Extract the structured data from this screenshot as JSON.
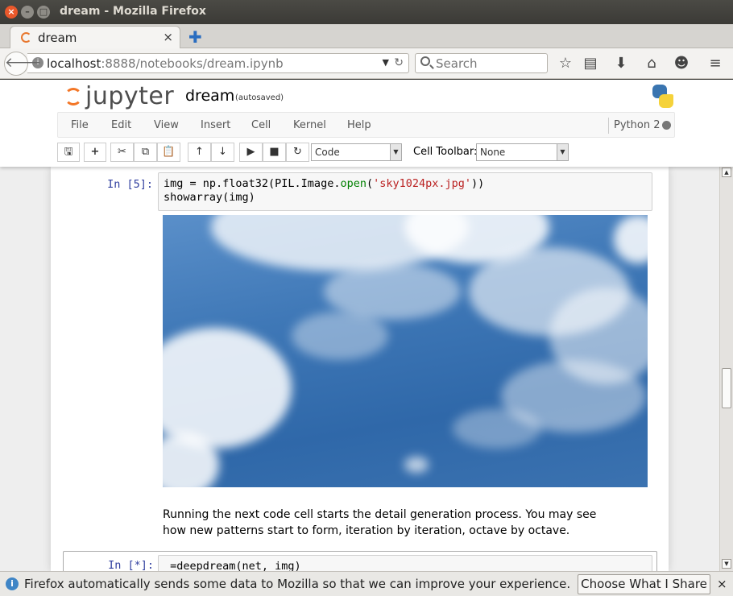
{
  "window": {
    "title": "dream - Mozilla Firefox"
  },
  "tab": {
    "label": "dream",
    "close": "×",
    "new": "✚"
  },
  "navbar": {
    "url_host": "localhost",
    "url_path": ":8888/notebooks/dream.ipynb",
    "search_placeholder": "Search"
  },
  "jupyter": {
    "logo_text": "jupyter",
    "notebook_name": "dream",
    "save_status": "(autosaved)",
    "menu": [
      "File",
      "Edit",
      "View",
      "Insert",
      "Cell",
      "Kernel",
      "Help"
    ],
    "kernel_name": "Python 2",
    "cell_type": "Code",
    "cell_toolbar_label": "Cell Toolbar:",
    "cell_toolbar_value": "None"
  },
  "cells": {
    "cell1_prompt": "In [5]:",
    "cell1_line1_a": "img = np.float32(PIL.Image.",
    "cell1_line1_fn": "open",
    "cell1_line1_b": "(",
    "cell1_line1_str": "'sky1024px.jpg'",
    "cell1_line1_c": "))",
    "cell1_line2": "showarray(img)",
    "markdown": "Running the next code cell starts the detail generation process. You may see how new patterns start to form, iteration by iteration, octave by octave.",
    "cell2_prompt": "In [*]:",
    "cell2_code": "_=deepdream(net, img)"
  },
  "notification": {
    "text": "Firefox automatically sends some data to Mozilla so that we can improve your experience.",
    "button": "Choose What I Share",
    "close": "×"
  }
}
